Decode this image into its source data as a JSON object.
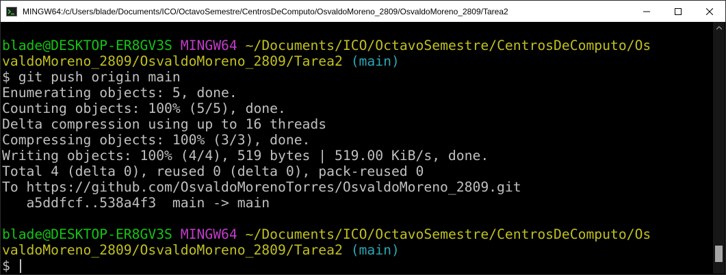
{
  "window": {
    "title": "MINGW64:/c/Users/blade/Documents/ICO/OctavoSemestre/CentrosDeComputo/OsvaldoMoreno_2809/OsvaldoMoreno_2809/Tarea2",
    "app_icon": "mingw-terminal-icon",
    "controls": [
      "minimize-icon",
      "maximize-icon",
      "close-icon"
    ]
  },
  "prompt1": {
    "user_host": "blade@DESKTOP-ER8GV3S",
    "env": "MINGW64",
    "path_line1": "~/Documents/ICO/OctavoSemestre/CentrosDeComputo/Os",
    "path_line2": "valdoMoreno_2809/OsvaldoMoreno_2809/Tarea2",
    "branch": "(main)",
    "symbol": "$",
    "command": "git push origin main"
  },
  "output": [
    "Enumerating objects: 5, done.",
    "Counting objects: 100% (5/5), done.",
    "Delta compression using up to 16 threads",
    "Compressing objects: 100% (3/3), done.",
    "Writing objects: 100% (4/4), 519 bytes | 519.00 KiB/s, done.",
    "Total 4 (delta 0), reused 0 (delta 0), pack-reused 0",
    "To https://github.com/OsvaldoMorenoTorres/OsvaldoMoreno_2809.git",
    "   a5ddfcf..538a4f3  main -> main"
  ],
  "prompt2": {
    "user_host": "blade@DESKTOP-ER8GV3S",
    "env": "MINGW64",
    "path_line1": "~/Documents/ICO/OctavoSemestre/CentrosDeComputo/Os",
    "path_line2": "valdoMoreno_2809/OsvaldoMoreno_2809/Tarea2",
    "branch": "(main)",
    "symbol": "$"
  },
  "colors": {
    "user_host": "#13c513",
    "env": "#c03cc8",
    "path": "#c0c020",
    "branch": "#2aa7b4",
    "text": "#c0c0c0",
    "background": "#000000"
  }
}
